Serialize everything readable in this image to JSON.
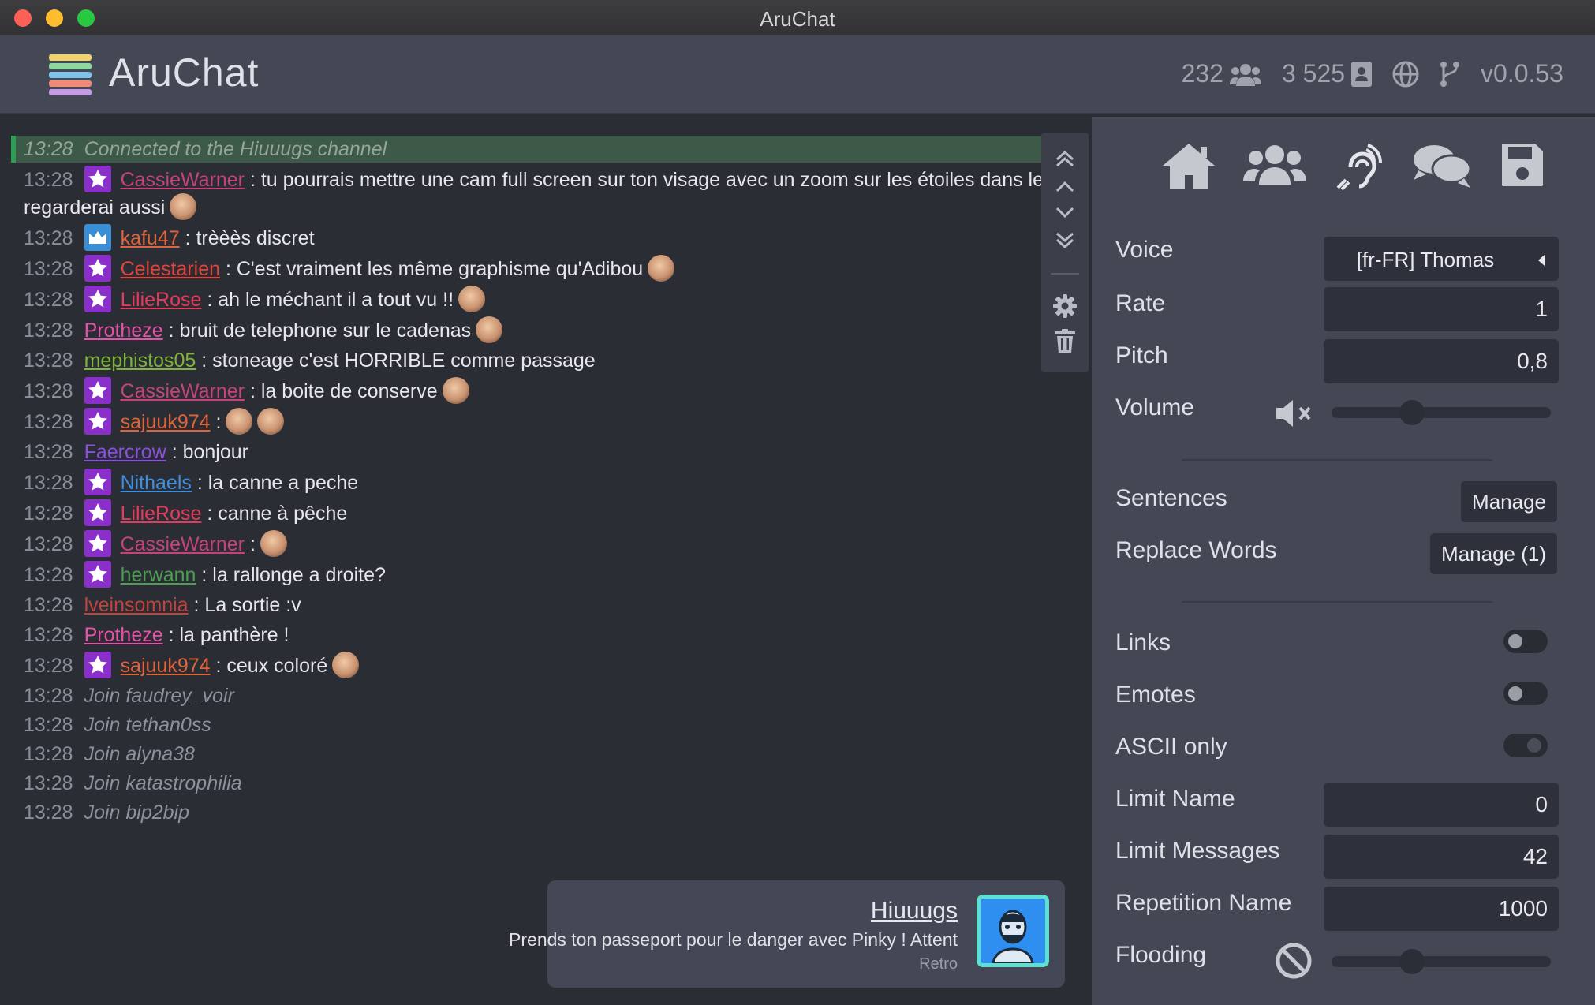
{
  "window": {
    "title": "AruChat"
  },
  "header": {
    "brand": "AruChat",
    "viewers": "232",
    "followers": "3 525",
    "version": "v0.0.53"
  },
  "chat": {
    "system": {
      "time": "13:28",
      "text": "Connected to the Hiuuugs channel"
    },
    "messages": [
      {
        "time": "13:28",
        "badge": "star",
        "user": "CassieWarner",
        "color": "#c4447a",
        "text": " : tu pourrais mettre une cam full screen sur ton visage avec un zoom sur les étoiles dans les yeux que je",
        "cont": "regarderai aussi",
        "emotes": 1
      },
      {
        "time": "13:28",
        "badge": "crown",
        "user": "kafu47",
        "color": "#e0643a",
        "text": " : trèèès discret",
        "emotes": 0
      },
      {
        "time": "13:28",
        "badge": "star",
        "user": "Celestarien",
        "color": "#e0443a",
        "text": " : C'est vraiment les même graphisme qu'Adibou",
        "emotes": 1
      },
      {
        "time": "13:28",
        "badge": "star",
        "user": "LilieRose",
        "color": "#e43a5c",
        "text": " : ah le méchant il a tout vu !!",
        "emotes": 1
      },
      {
        "time": "13:28",
        "badge": "",
        "user": "Protheze",
        "color": "#e553a8",
        "text": " : bruit de telephone sur le cadenas",
        "emotes": 1
      },
      {
        "time": "13:28",
        "badge": "",
        "user": "mephistos05",
        "color": "#7fb43a",
        "text": " : stoneage c'est HORRIBLE comme passage",
        "emotes": 0
      },
      {
        "time": "13:28",
        "badge": "star",
        "user": "CassieWarner",
        "color": "#c4447a",
        "text": " : la boite de conserve",
        "emotes": 1
      },
      {
        "time": "13:28",
        "badge": "star",
        "user": "sajuuk974",
        "color": "#e0643a",
        "text": " :",
        "emotes": 2
      },
      {
        "time": "13:28",
        "badge": "",
        "user": "Faercrow",
        "color": "#8a4fe0",
        "text": " : bonjour",
        "emotes": 0
      },
      {
        "time": "13:28",
        "badge": "star",
        "user": "Nithaels",
        "color": "#3f8fe0",
        "text": " : la canne a peche",
        "emotes": 0
      },
      {
        "time": "13:28",
        "badge": "star",
        "user": "LilieRose",
        "color": "#e43a5c",
        "text": " : canne à pêche",
        "emotes": 0
      },
      {
        "time": "13:28",
        "badge": "star",
        "user": "CassieWarner",
        "color": "#c4447a",
        "text": " :",
        "emotes": 1
      },
      {
        "time": "13:28",
        "badge": "star",
        "user": "herwann",
        "color": "#4e9e52",
        "text": " : la rallonge a droite?",
        "emotes": 0
      },
      {
        "time": "13:28",
        "badge": "",
        "user": "lveinsomnia",
        "color": "#c0443a",
        "text": " : La sortie :v",
        "emotes": 0
      },
      {
        "time": "13:28",
        "badge": "",
        "user": "Protheze",
        "color": "#e553a8",
        "text": " : la panthère !",
        "emotes": 0
      },
      {
        "time": "13:28",
        "badge": "star",
        "user": "sajuuk974",
        "color": "#e0643a",
        "text": " : ceux coloré",
        "emotes": 1
      }
    ],
    "joins": [
      {
        "time": "13:28",
        "text": "Join faudrey_voir"
      },
      {
        "time": "13:28",
        "text": "Join tethan0ss"
      },
      {
        "time": "13:28",
        "text": "Join alyna38"
      },
      {
        "time": "13:28",
        "text": "Join katastrophilia"
      },
      {
        "time": "13:28",
        "text": "Join bip2bip"
      }
    ]
  },
  "notification": {
    "name": "Hiuuugs",
    "text": "Prends ton passeport pour le danger avec Pinky ! Attent",
    "sub": "Retro"
  },
  "settings": {
    "voice_label": "Voice",
    "voice_value": "[fr-FR] Thomas",
    "rate_label": "Rate",
    "rate_value": "1",
    "pitch_label": "Pitch",
    "pitch_value": "0,8",
    "volume_label": "Volume",
    "volume_level": 0.35,
    "sentences_label": "Sentences",
    "sentences_button": "Manage",
    "replace_label": "Replace Words",
    "replace_button": "Manage (1)",
    "links_label": "Links",
    "links_on": false,
    "emotes_label": "Emotes",
    "emotes_on": false,
    "ascii_label": "ASCII only",
    "ascii_on": false,
    "limit_name_label": "Limit Name",
    "limit_name_value": "0",
    "limit_messages_label": "Limit Messages",
    "limit_messages_value": "42",
    "repetition_label": "Repetition Name",
    "repetition_value": "1000",
    "flooding_label": "Flooding",
    "flooding_level": 0.35
  }
}
